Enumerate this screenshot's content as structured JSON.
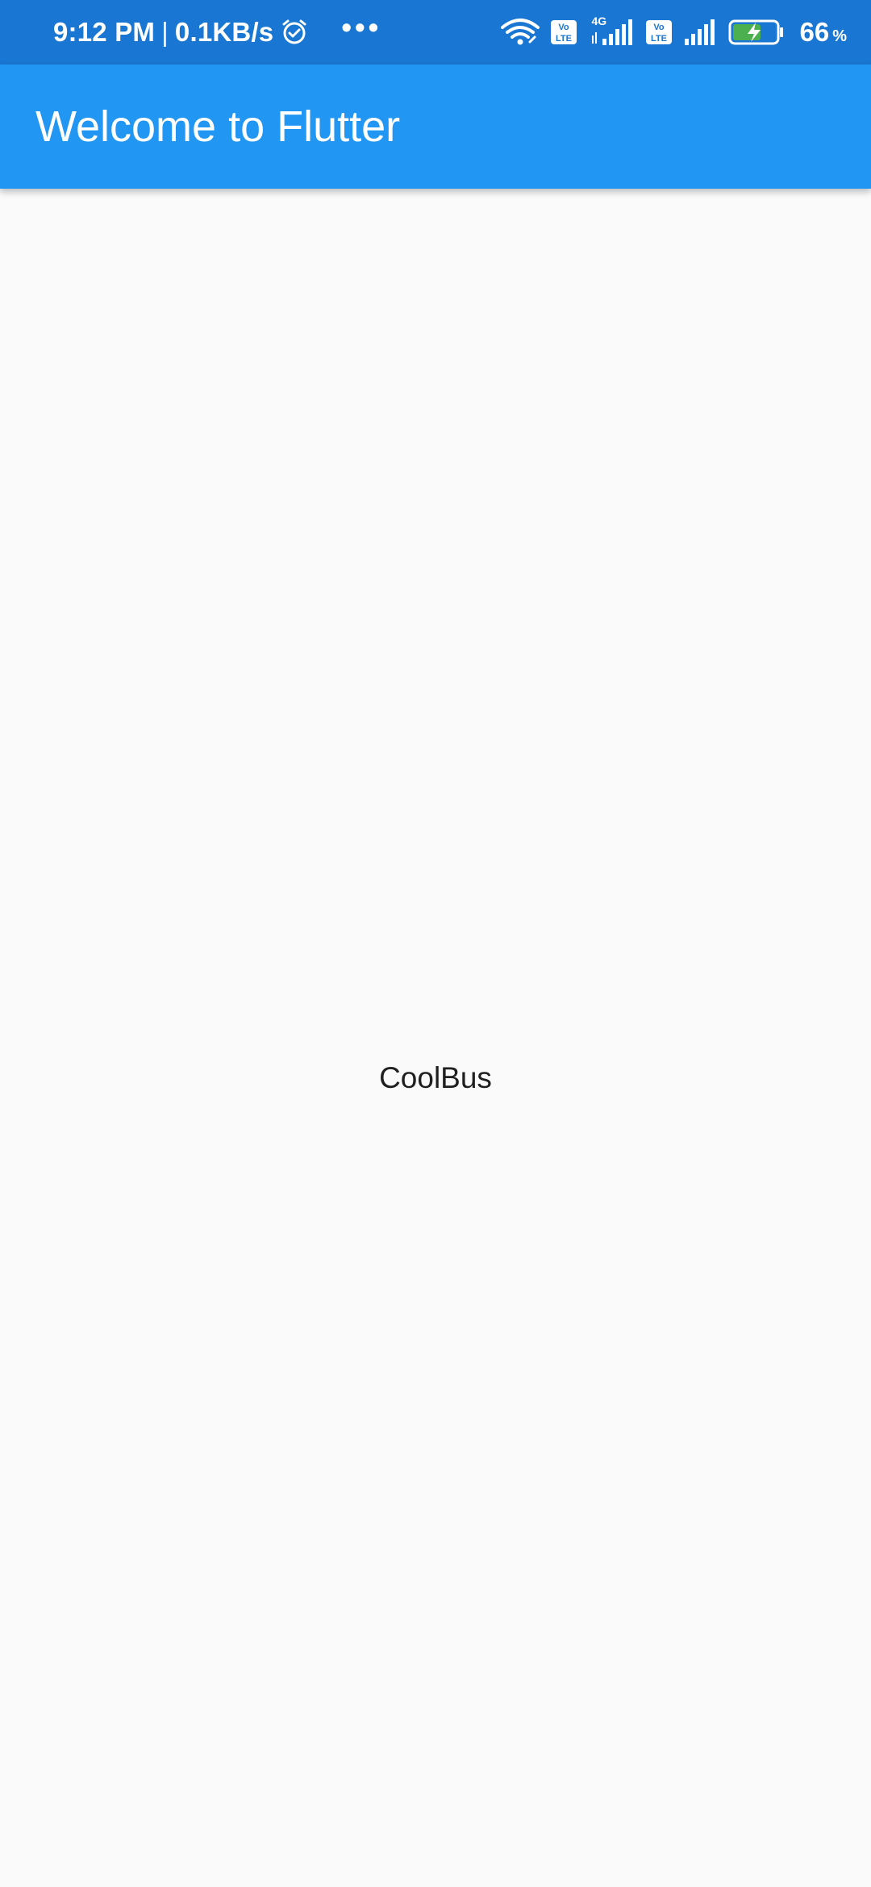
{
  "status_bar": {
    "time": "9:12 PM",
    "separator": "|",
    "speed": "0.1KB/s",
    "more_dots": "•••",
    "network_label": "4G",
    "battery_level": "66",
    "battery_unit": "%",
    "icons": [
      "alarm-icon",
      "wifi-icon",
      "volte-icon",
      "signal-icon",
      "volte-icon",
      "signal-icon",
      "battery-charging-icon"
    ],
    "colors": {
      "background": "#1976d2",
      "battery_fill": "#4caf50"
    }
  },
  "app_bar": {
    "title": "Welcome to Flutter",
    "color": "#2196f3"
  },
  "body": {
    "text": "CoolBus",
    "background": "#fafafa"
  }
}
